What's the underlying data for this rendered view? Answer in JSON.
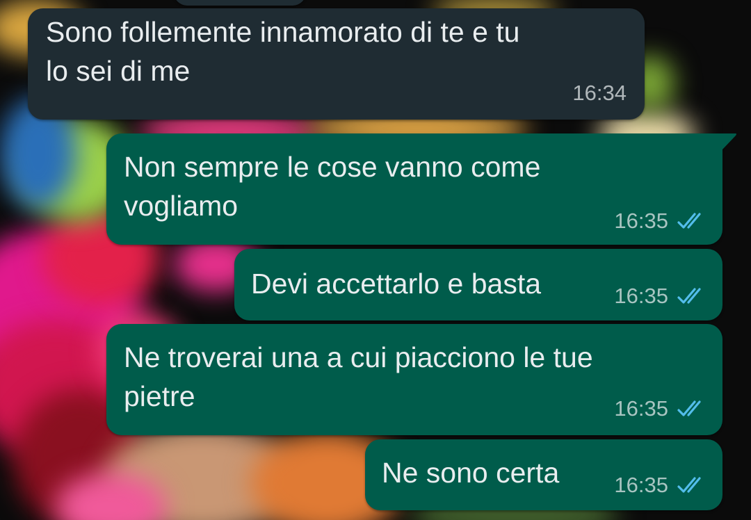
{
  "messages": [
    {
      "direction": "incoming",
      "text_line1": "Sono follemente innamorato di te e tu",
      "text_line2": "lo sei di me",
      "time": "16:34"
    },
    {
      "direction": "outgoing",
      "text_line1": "Non sempre le cose vanno come",
      "text_line2": "vogliamo",
      "time": "16:35",
      "status": "read"
    },
    {
      "direction": "outgoing",
      "text_line1": "Devi accettarlo e basta",
      "time": "16:35",
      "status": "read"
    },
    {
      "direction": "outgoing",
      "text_line1": "Ne troverai una a cui piacciono le tue",
      "text_line2": "pietre",
      "time": "16:35",
      "status": "read"
    },
    {
      "direction": "outgoing",
      "text_line1": "Ne sono certa",
      "time": "16:35",
      "status": "read"
    }
  ],
  "colors": {
    "incoming_bubble": "#1f2c33",
    "outgoing_bubble": "#005c4b",
    "read_ticks": "#53bdeb",
    "text": "#e9edef"
  },
  "icons": {
    "read_receipt": "double-check-icon"
  }
}
